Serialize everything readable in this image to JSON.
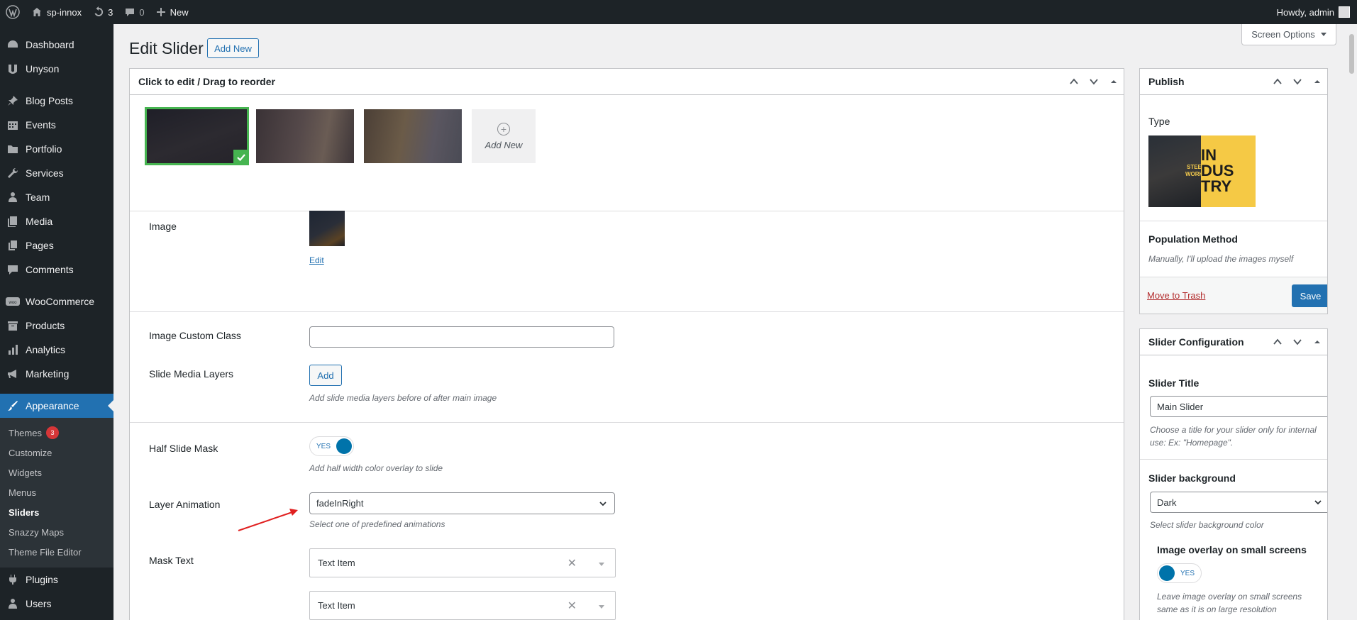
{
  "adminbar": {
    "site_name": "sp-innox",
    "updates_count": "3",
    "comments_count": "0",
    "new_label": "New",
    "howdy": "Howdy, admin"
  },
  "sidebar": {
    "items": [
      {
        "label": "Dashboard",
        "icon": "dashboard-icon"
      },
      {
        "label": "Unyson",
        "icon": "unyson-icon"
      },
      {
        "label": "Blog Posts",
        "icon": "pin-icon"
      },
      {
        "label": "Events",
        "icon": "calendar-icon"
      },
      {
        "label": "Portfolio",
        "icon": "folder-icon"
      },
      {
        "label": "Services",
        "icon": "wrench-icon"
      },
      {
        "label": "Team",
        "icon": "person-icon"
      },
      {
        "label": "Media",
        "icon": "media-icon"
      },
      {
        "label": "Pages",
        "icon": "pages-icon"
      },
      {
        "label": "Comments",
        "icon": "comment-icon"
      },
      {
        "label": "WooCommerce",
        "icon": "woo-icon"
      },
      {
        "label": "Products",
        "icon": "archive-icon"
      },
      {
        "label": "Analytics",
        "icon": "bar-chart-icon"
      },
      {
        "label": "Marketing",
        "icon": "megaphone-icon"
      },
      {
        "label": "Appearance",
        "icon": "paintbrush-icon"
      }
    ],
    "appearance_sub": [
      {
        "label": "Themes",
        "badge": "3"
      },
      {
        "label": "Customize"
      },
      {
        "label": "Widgets"
      },
      {
        "label": "Menus"
      },
      {
        "label": "Sliders"
      },
      {
        "label": "Snazzy Maps"
      },
      {
        "label": "Theme File Editor"
      }
    ],
    "after": [
      {
        "label": "Plugins",
        "icon": "plug-icon"
      },
      {
        "label": "Users",
        "icon": "users-icon"
      }
    ]
  },
  "header": {
    "title": "Edit Slider",
    "add_new": "Add New",
    "screen_options": "Screen Options"
  },
  "main_box": {
    "title": "Click to edit / Drag to reorder",
    "add_new_thumb": "Add New",
    "image_label": "Image",
    "edit_link": "Edit",
    "custom_class_label": "Image Custom Class",
    "custom_class_value": "",
    "media_layers_label": "Slide Media Layers",
    "add_button": "Add",
    "media_layers_help": "Add slide media layers before of after main image",
    "half_mask_label": "Half Slide Mask",
    "toggle_yes": "YES",
    "half_mask_help": "Add half width color overlay to slide",
    "layer_animation_label": "Layer Animation",
    "layer_animation_value": "fadeInRight",
    "layer_animation_help": "Select one of predefined animations",
    "mask_text_label": "Mask Text",
    "mask_items": [
      "Text Item",
      "Text Item"
    ]
  },
  "publish": {
    "title": "Publish",
    "type_label": "Type",
    "preview_text": [
      "STEEL",
      "WORKS",
      "IN",
      "DUS",
      "TRY"
    ],
    "population_label": "Population Method",
    "population_value": "Manually, I'll upload the images myself",
    "trash": "Move to Trash",
    "save": "Save"
  },
  "config": {
    "title": "Slider Configuration",
    "slider_title_label": "Slider Title",
    "slider_title_value": "Main Slider",
    "slider_title_help": "Choose a title for your slider only for internal use: Ex: \"Homepage\".",
    "background_label": "Slider background",
    "background_value": "Dark",
    "background_help": "Select slider background color",
    "overlay_label": "Image overlay on small screens",
    "overlay_toggle": "YES",
    "overlay_help": "Leave image overlay on small screens same as it is on large resolution"
  },
  "colors": {
    "admin_dark": "#1d2327",
    "accent": "#2271b1",
    "selected_green": "#46b450",
    "annotation_red": "#e02020"
  }
}
